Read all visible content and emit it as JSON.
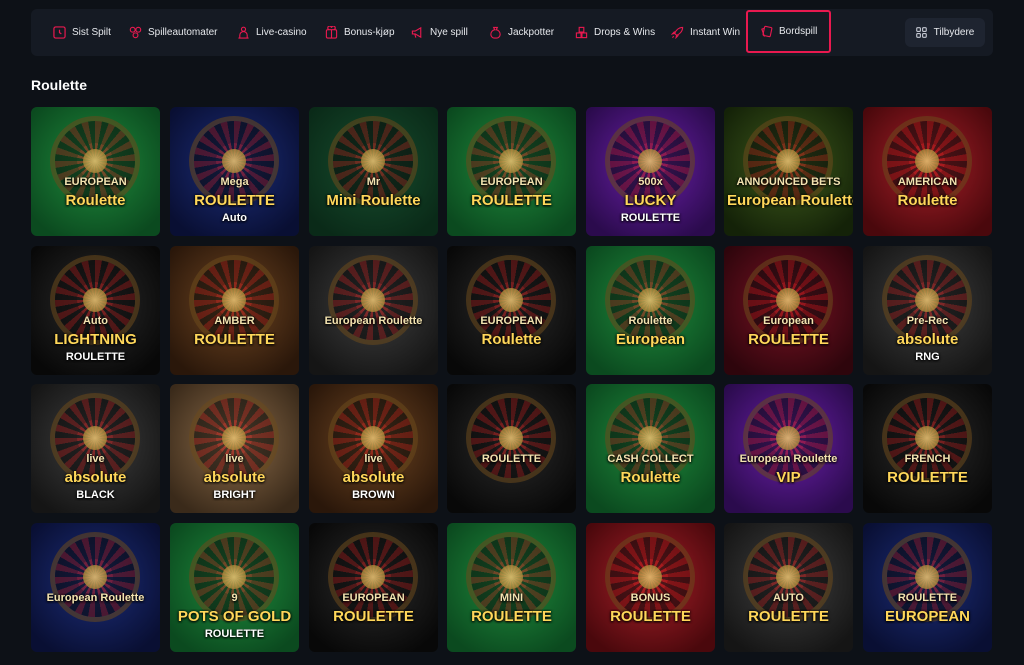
{
  "nav": {
    "items": [
      {
        "label": "Sist Spilt",
        "icon": "clock-icon"
      },
      {
        "label": "Spilleautomater",
        "icon": "slot-machine-icon"
      },
      {
        "label": "Live-casino",
        "icon": "live-dealer-icon"
      },
      {
        "label": "Bonus-kjøp",
        "icon": "bonus-buy-icon"
      },
      {
        "label": "Nye spill",
        "icon": "megaphone-icon"
      },
      {
        "label": "Jackpotter",
        "icon": "money-bag-icon"
      },
      {
        "label": "Drops & Wins",
        "icon": "drops-wins-icon"
      },
      {
        "label": "Instant Win",
        "icon": "rocket-icon"
      },
      {
        "label": "Bordspill",
        "icon": "cards-icon",
        "active": true
      }
    ],
    "providers_label": "Tilbydere",
    "providers_icon": "grid-icon",
    "active_color": "#e8194f"
  },
  "section_title": "Roulette",
  "games": [
    {
      "t1": "EUROPEAN",
      "t2": "Roulette",
      "t3": "",
      "theme": "green"
    },
    {
      "t1": "Mega",
      "t2": "ROULETTE",
      "t3": "Auto",
      "theme": "navy"
    },
    {
      "t1": "Mr",
      "t2": "Mini Roulette",
      "t3": "",
      "theme": "darkgreen"
    },
    {
      "t1": "EUROPEAN",
      "t2": "ROULETTE",
      "t3": "",
      "theme": "green"
    },
    {
      "t1": "500x",
      "t2": "LUCKY",
      "t3": "ROULETTE",
      "theme": "purple"
    },
    {
      "t1": "ANNOUNCED BETS",
      "t2": "European Roulette",
      "t3": "",
      "theme": "olive"
    },
    {
      "t1": "AMERICAN",
      "t2": "Roulette",
      "t3": "",
      "theme": "red"
    },
    {
      "t1": "Auto",
      "t2": "LIGHTNING",
      "t3": "ROULETTE",
      "theme": "black"
    },
    {
      "t1": "AMBER",
      "t2": "ROULETTE",
      "t3": "",
      "theme": "brown"
    },
    {
      "t1": "European Roulette",
      "t2": "",
      "t3": "",
      "theme": "charcoal"
    },
    {
      "t1": "EUROPEAN",
      "t2": "Roulette",
      "t3": "",
      "theme": "black"
    },
    {
      "t1": "Roulette",
      "t2": "European",
      "t3": "",
      "theme": "green"
    },
    {
      "t1": "European",
      "t2": "ROULETTE",
      "t3": "",
      "theme": "wine"
    },
    {
      "t1": "Pre-Rec",
      "t2": "absolute",
      "t3": "RNG",
      "theme": "charcoal"
    },
    {
      "t1": "live",
      "t2": "absolute",
      "t3": "BLACK",
      "theme": "charcoal"
    },
    {
      "t1": "live",
      "t2": "absolute",
      "t3": "BRIGHT",
      "theme": "tan"
    },
    {
      "t1": "live",
      "t2": "absolute",
      "t3": "BROWN",
      "theme": "brown"
    },
    {
      "t1": "ROULETTE",
      "t2": "",
      "t3": "",
      "theme": "black"
    },
    {
      "t1": "CASH COLLECT",
      "t2": "Roulette",
      "t3": "",
      "theme": "green"
    },
    {
      "t1": "European Roulette",
      "t2": "VIP",
      "t3": "",
      "theme": "purple"
    },
    {
      "t1": "FRENCH",
      "t2": "ROULETTE",
      "t3": "",
      "theme": "black"
    },
    {
      "t1": "European Roulette",
      "t2": "",
      "t3": "",
      "theme": "navy"
    },
    {
      "t1": "9",
      "t2": "POTS OF GOLD",
      "t3": "ROULETTE",
      "theme": "green"
    },
    {
      "t1": "EUROPEAN",
      "t2": "ROULETTE",
      "t3": "",
      "theme": "black"
    },
    {
      "t1": "MINI",
      "t2": "ROULETTE",
      "t3": "",
      "theme": "green"
    },
    {
      "t1": "BONUS",
      "t2": "ROULETTE",
      "t3": "",
      "theme": "red"
    },
    {
      "t1": "AUTO",
      "t2": "ROULETTE",
      "t3": "",
      "theme": "charcoal"
    },
    {
      "t1": "ROULETTE",
      "t2": "EUROPEAN",
      "t3": "",
      "theme": "navy"
    }
  ]
}
